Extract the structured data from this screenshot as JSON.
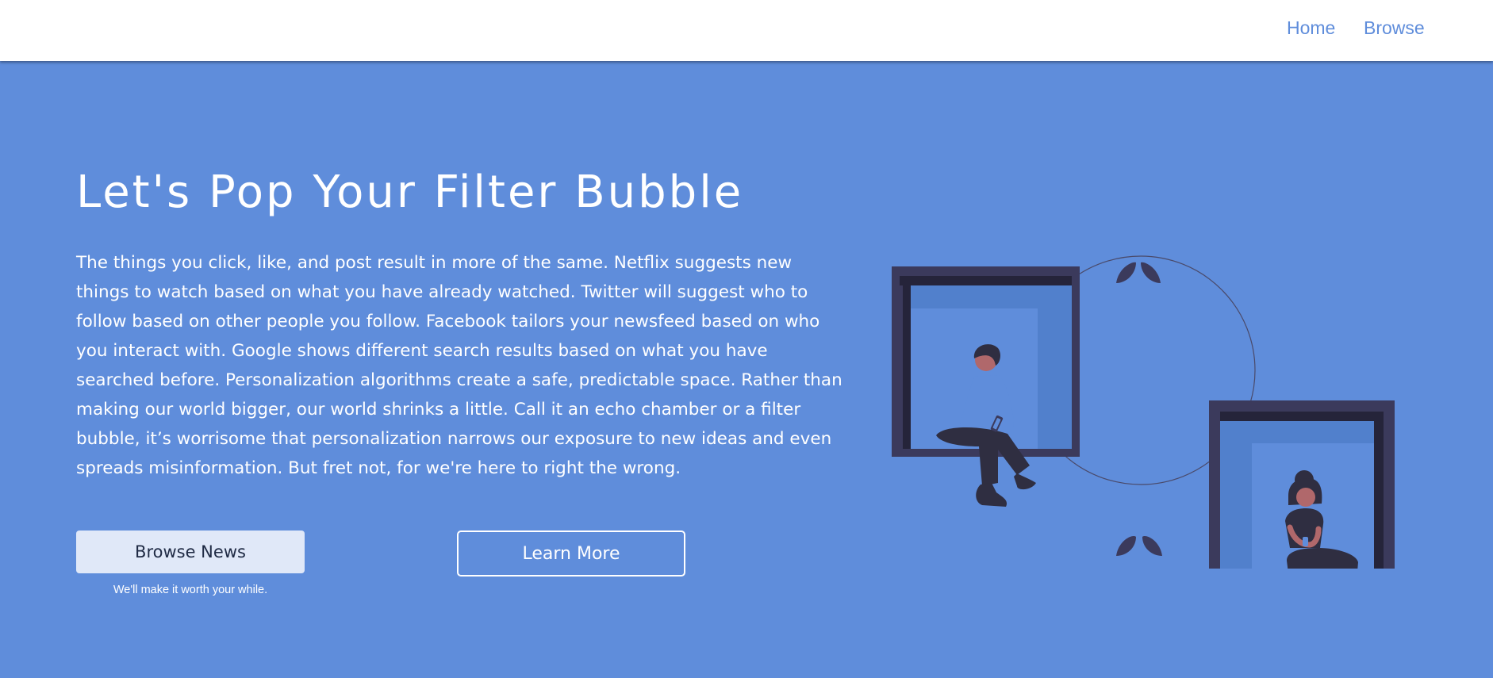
{
  "nav": {
    "home_label": "Home",
    "browse_label": "Browse"
  },
  "hero": {
    "title": "Let's Pop Your Filter Bubble",
    "body": "The things you click, like, and post result in more of the same. Netflix suggests new things to watch based on what you have already watched. Twitter will suggest who to follow based on other people you follow. Facebook tailors your newsfeed based on who you interact with. Google shows different search results based on what you have searched before. Personalization algorithms create a safe, predictable space. Rather than making our world bigger, our world shrinks a little. Call it an echo chamber or a filter bubble, it’s worrisome that personalization narrows our exposure to new ideas and even spreads misinformation. But fret not, for we're here to right the wrong.",
    "browse_button_label": "Browse News",
    "browse_caption": "We'll make it worth your while.",
    "learn_button_label": "Learn More"
  },
  "illustration": {
    "icon": "two-people-in-windows-illustration"
  },
  "colors": {
    "hero_background": "#5f8ddb",
    "navbar_background": "#ffffff",
    "nav_link": "#5f8ddb",
    "frame_dark": "#3b3a5c",
    "button_light": "#e0e8f8"
  }
}
